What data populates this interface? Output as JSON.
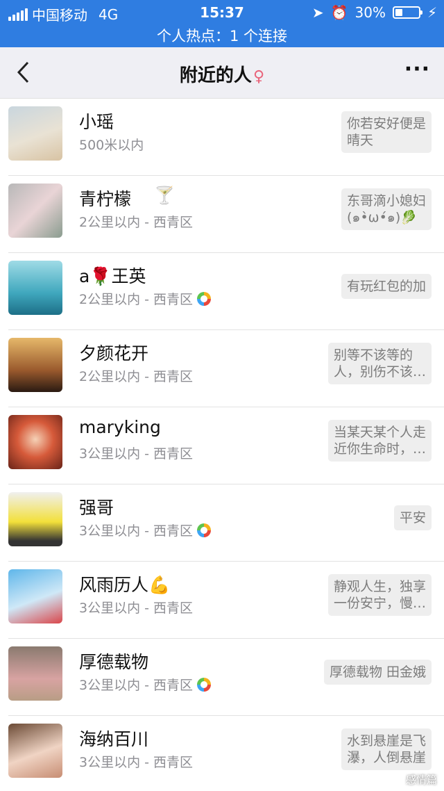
{
  "statusbar": {
    "carrier": "中国移动",
    "network": "4G",
    "time": "15:37",
    "battery": "30%",
    "battery_level": 0.3,
    "hotspot_text": "个人热点：1 个连接",
    "icons": [
      "signal-icon",
      "location-arrow-icon",
      "alarm-clock-icon",
      "battery-icon",
      "charging-icon"
    ]
  },
  "navbar": {
    "back_icon": "chevron-left-icon",
    "title": "附近的人",
    "more_icon": "more-dots-icon",
    "title_glyph": "♀"
  },
  "people": [
    {
      "name": "小瑶",
      "distance": "500米以内",
      "signature": [
        "你若安好便是",
        "晴天"
      ],
      "moments": false
    },
    {
      "name": "青柠檬",
      "name_suffix": "🍸",
      "distance": "2公里以内 - 西青区",
      "signature": [
        "东哥滴小媳妇",
        "(๑•̀ω•́๑)🥬"
      ],
      "moments": false
    },
    {
      "name": "a🌹王英",
      "distance": "2公里以内 - 西青区",
      "signature": [
        "有玩红包的加"
      ],
      "moments": true
    },
    {
      "name": "夕颜花开",
      "distance": "2公里以内 - 西青区",
      "signature": [
        "别等不该等的",
        "人，别伤不该…"
      ],
      "moments": false
    },
    {
      "name": "maryking",
      "distance": "3公里以内 - 西青区",
      "signature": [
        "当某天某个人走",
        "近你生命时，…"
      ],
      "moments": false
    },
    {
      "name": "强哥",
      "distance": "3公里以内 - 西青区",
      "signature": [
        "平安"
      ],
      "moments": true
    },
    {
      "name": "风雨历人💪",
      "distance": "3公里以内 - 西青区",
      "signature": [
        "静观人生，独享",
        "一份安宁，慢…"
      ],
      "moments": false
    },
    {
      "name": "厚德载物",
      "distance": "3公里以内 - 西青区",
      "signature": [
        "厚德载物 田金娥"
      ],
      "moments": true
    },
    {
      "name": "海纳百川",
      "distance": "3公里以内 - 西青区",
      "signature": [
        "水到悬崖是飞",
        "瀑，人倒悬崖"
      ],
      "moments": false
    }
  ],
  "watermark": "感情篇"
}
